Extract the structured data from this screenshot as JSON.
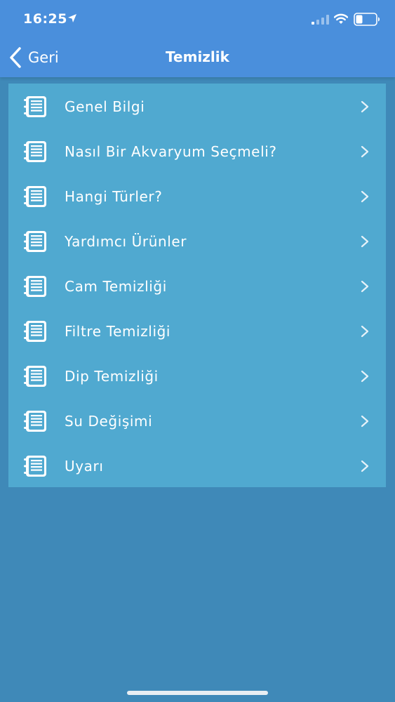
{
  "status_bar": {
    "time": "16:25"
  },
  "nav": {
    "back_label": "Geri",
    "title": "Temizlik"
  },
  "list": {
    "items": [
      {
        "label": "Genel Bilgi"
      },
      {
        "label": "Nasıl Bir Akvaryum Seçmeli?"
      },
      {
        "label": "Hangi Türler?"
      },
      {
        "label": "Yardımcı Ürünler"
      },
      {
        "label": "Cam Temizliği"
      },
      {
        "label": "Filtre Temizliği"
      },
      {
        "label": "Dip Temizliği"
      },
      {
        "label": "Su Değişimi"
      },
      {
        "label": "Uyarı"
      }
    ]
  },
  "colors": {
    "header_bg": "#4a8fdc",
    "page_bg": "#3f89b8",
    "list_bg": "#50a9d0",
    "text": "#ffffff"
  },
  "icons": {
    "item_icon": "notebook-icon",
    "item_chevron": "chevron-right-icon",
    "back": "chevron-left-icon"
  }
}
